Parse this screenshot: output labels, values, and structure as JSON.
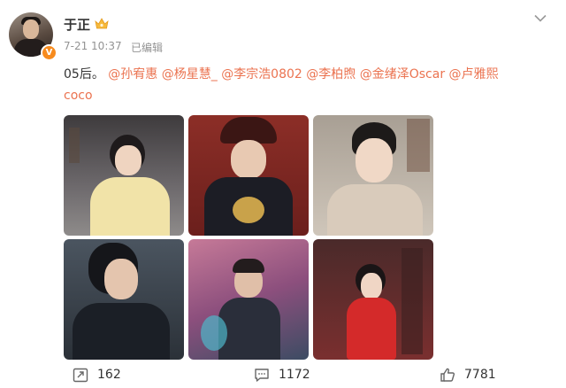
{
  "author": {
    "name": "于正",
    "time": "7-21 10:37",
    "edited": "已编辑",
    "verify": "V"
  },
  "post": {
    "prefix": "05后。",
    "mentions": [
      "@孙宥惠",
      "@杨星慧_",
      "@李宗浩0802",
      "@李柏煦",
      "@金绪泽Oscar",
      "@卢雅熙"
    ],
    "tail": "coco"
  },
  "images": [
    {
      "name": "photo-1"
    },
    {
      "name": "photo-2"
    },
    {
      "name": "photo-3"
    },
    {
      "name": "photo-4"
    },
    {
      "name": "photo-5"
    },
    {
      "name": "photo-6"
    }
  ],
  "actions": {
    "repost_count": "162",
    "comment_count": "1172",
    "like_count": "7781"
  },
  "icons": [
    "crown-icon",
    "chevron-down-icon",
    "repost-icon",
    "comment-icon",
    "like-icon"
  ],
  "colors": {
    "mention": "#eb7350",
    "verify": "#f78b1e",
    "meta": "#939393"
  }
}
